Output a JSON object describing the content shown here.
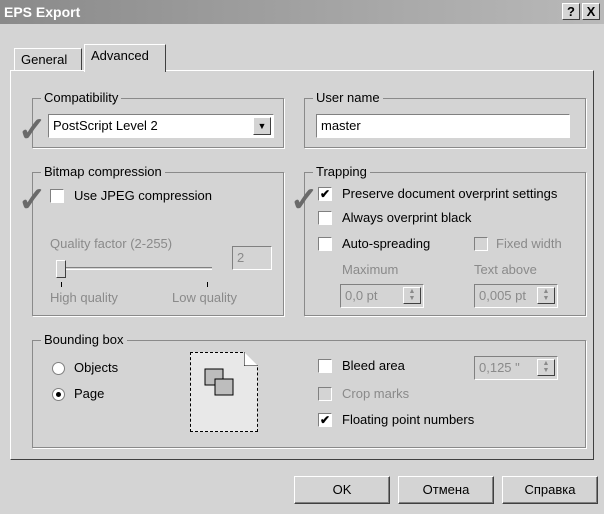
{
  "window": {
    "title": "EPS Export",
    "help_button": "?",
    "close_button": "X"
  },
  "tabs": [
    {
      "label": "General",
      "active": false
    },
    {
      "label": "Advanced",
      "active": true
    }
  ],
  "compatibility": {
    "group_label": "Compatibility",
    "selected": "PostScript Level 2"
  },
  "user_name": {
    "group_label": "User name",
    "value": "master"
  },
  "bitmap_compression": {
    "group_label": "Bitmap compression",
    "use_jpeg_label": "Use JPEG compression",
    "use_jpeg_checked": false,
    "quality_factor_label": "Quality factor (2-255)",
    "quality_value": "2",
    "quality_level": 0,
    "high_quality_label": "High quality",
    "low_quality_label": "Low quality"
  },
  "trapping": {
    "group_label": "Trapping",
    "preserve_label": "Preserve document overprint settings",
    "preserve_checked": true,
    "always_overprint_label": "Always overprint black",
    "always_overprint_checked": false,
    "auto_spreading_label": "Auto-spreading",
    "auto_spreading_checked": false,
    "fixed_width_label": "Fixed width",
    "fixed_width_checked": false,
    "maximum_label": "Maximum",
    "maximum_value": "0,0 pt",
    "text_above_label": "Text above",
    "text_above_value": "0,005 pt"
  },
  "bounding_box": {
    "group_label": "Bounding box",
    "objects_label": "Objects",
    "page_label": "Page",
    "selected": "Page",
    "bleed_area_label": "Bleed area",
    "bleed_area_checked": false,
    "bleed_value": "0,125 \"",
    "crop_marks_label": "Crop marks",
    "crop_marks_checked": false,
    "floating_point_label": "Floating point numbers",
    "floating_point_checked": true
  },
  "buttons": {
    "ok": "OK",
    "cancel": "Отмена",
    "help": "Справка"
  },
  "icons": {
    "checkmark": "✔",
    "annotation_tick": "✓",
    "dropdown": "▼",
    "spin_up": "▲",
    "spin_down": "▼"
  }
}
